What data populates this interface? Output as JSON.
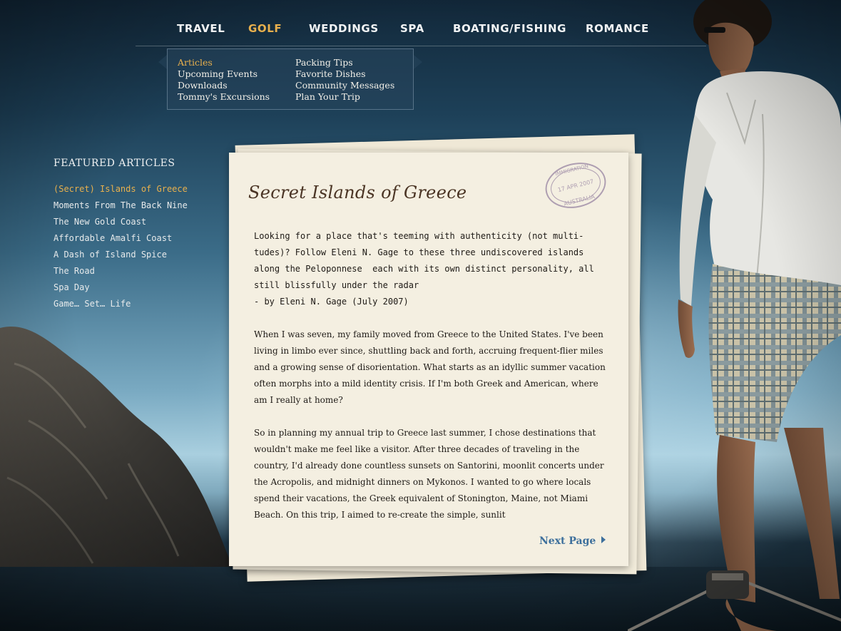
{
  "colors": {
    "nav_active": "#e8b04d",
    "nav_text": "#f2f4f5",
    "link_blue": "#3d6f9c",
    "paper": "#f4efe1",
    "ink": "#1e1a16",
    "title_ink": "#4a3424"
  },
  "nav": {
    "items": [
      "TRAVEL",
      "GOLF",
      "WEDDINGS",
      "SPA",
      "BOATING/FISHING",
      "ROMANCE"
    ],
    "active": "GOLF"
  },
  "submenu": {
    "col1": [
      "Articles",
      "Upcoming Events",
      "Downloads",
      "Tommy's Excursions"
    ],
    "col2": [
      "Packing Tips",
      "Favorite Dishes",
      "Community Messages",
      "Plan Your Trip"
    ],
    "active": "Articles"
  },
  "featured": {
    "heading": "FEATURED ARTICLES",
    "items": [
      "(Secret) Islands of Greece",
      "Moments From The Back Nine",
      "The New Gold Coast",
      "Affordable Amalfi Coast",
      "A Dash of Island Spice",
      "The Road",
      "Spa Day",
      "Game… Set… Life"
    ],
    "active_index": 0
  },
  "article": {
    "title": "Secret Islands of Greece",
    "stamp_text": [
      "IMMIGRATION",
      "17 APR 2007",
      "AUSTRALIA"
    ],
    "intro_lines": [
      "Looking for a place that's teeming with authenticity (not multi-",
      "tudes)? Follow Eleni N. Gage to these three undiscovered islands",
      "along the Peloponnese  each with its own distinct personality, all",
      "still blissfully under the radar",
      "- by Eleni N. Gage (July 2007)"
    ],
    "paragraphs": [
      "When I was seven, my family moved from Greece to the United States. I've been living in limbo ever since, shuttling back and forth, accruing frequent-flier miles and a growing sense of disorientation. What starts as an idyllic summer vacation often morphs into a mild identity crisis. If I'm both Greek and American, where am I really at home?",
      "So in planning my annual trip to Greece last summer, I chose destinations that wouldn't make me feel like a visitor. After three decades of traveling in the country, I'd already done countless sunsets on Santorini, moonlit concerts under the Acropolis, and midnight dinners on Mykonos. I wanted to go where locals spend their vacations, the Greek equivalent of Stonington, Maine, not Miami Beach. On this trip, I aimed to re-create the simple, sunlit"
    ],
    "next_page_label": "Next Page"
  }
}
